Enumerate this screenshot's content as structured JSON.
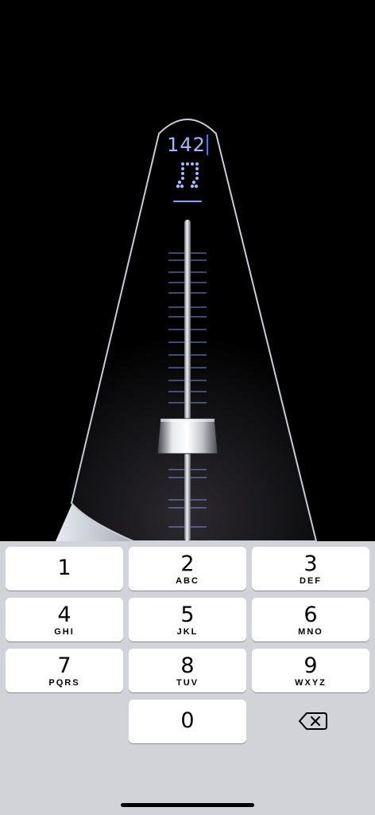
{
  "tempo": {
    "value": "142"
  },
  "icons": {
    "note": "eighth-notes-icon",
    "weight": "slider-weight-icon",
    "backspace": "backspace-icon"
  },
  "colors": {
    "accent": "#a9b6ff",
    "cursor": "#4d6bff",
    "keypad_bg": "#d1d3d9",
    "key_bg": "#ffffff"
  },
  "keypad": {
    "keys": [
      {
        "digit": "1",
        "letters": ""
      },
      {
        "digit": "2",
        "letters": "ABC"
      },
      {
        "digit": "3",
        "letters": "DEF"
      },
      {
        "digit": "4",
        "letters": "GHI"
      },
      {
        "digit": "5",
        "letters": "JKL"
      },
      {
        "digit": "6",
        "letters": "MNO"
      },
      {
        "digit": "7",
        "letters": "PQRS"
      },
      {
        "digit": "8",
        "letters": "TUV"
      },
      {
        "digit": "9",
        "letters": "WXYZ"
      },
      {
        "digit": "0",
        "letters": ""
      }
    ]
  }
}
